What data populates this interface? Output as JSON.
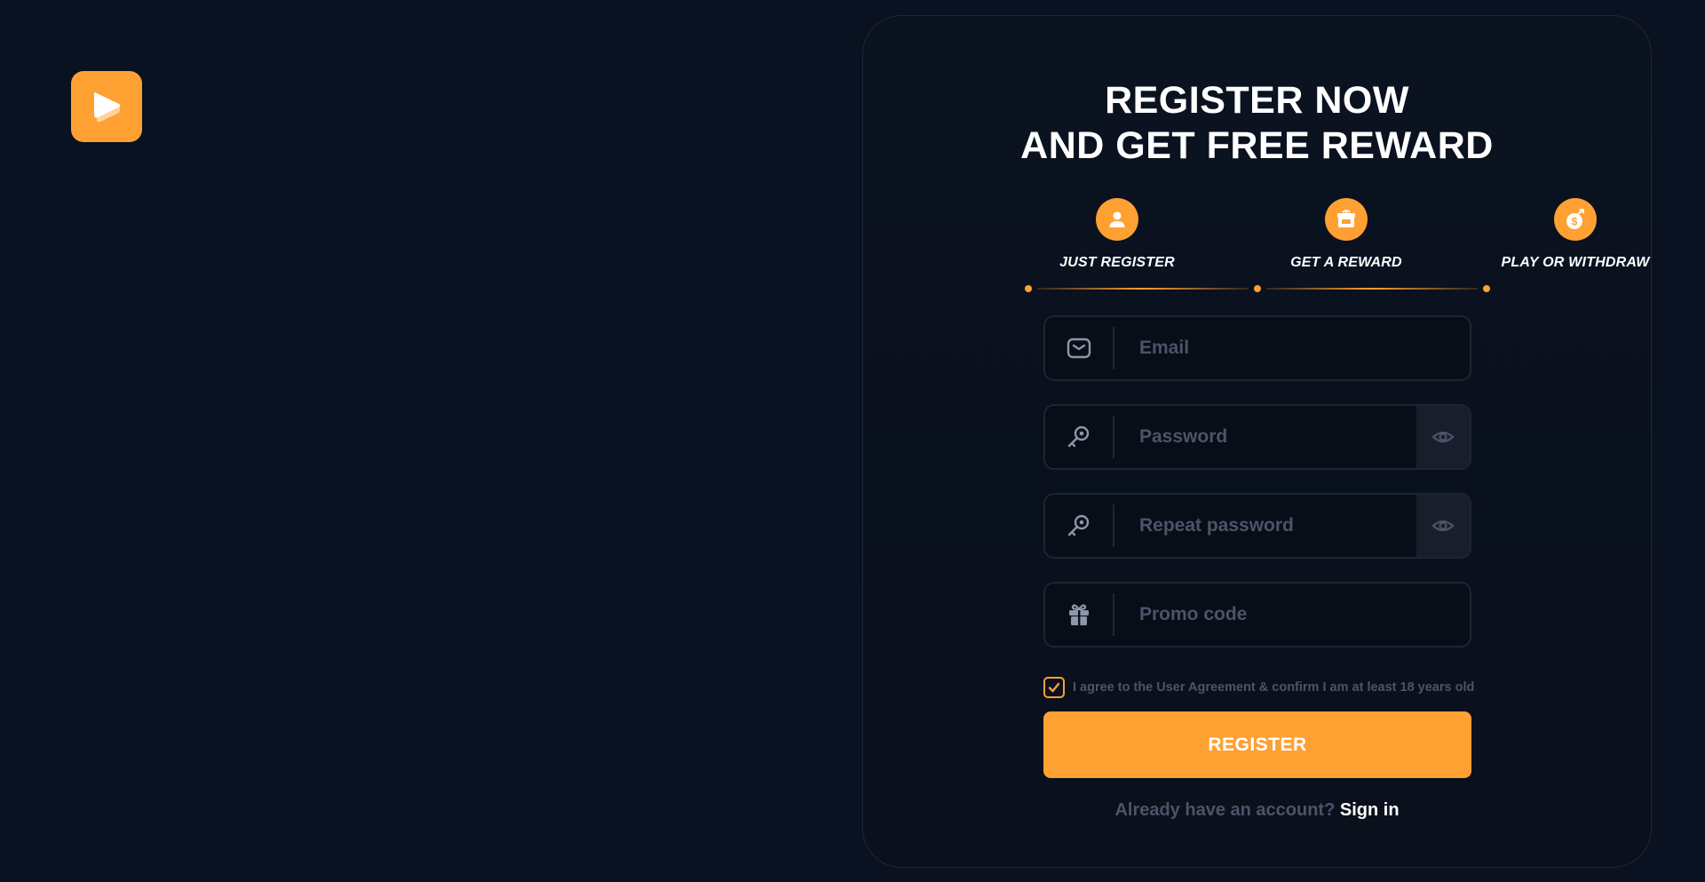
{
  "brand": {
    "accent": "#ffa033",
    "background": "#0a1120",
    "logo_icon": "play-icon"
  },
  "register": {
    "title_line1": "REGISTER NOW",
    "title_line2": "AND GET FREE REWARD",
    "steps": [
      {
        "label": "JUST REGISTER",
        "icon": "user-icon"
      },
      {
        "label": "GET A REWARD",
        "icon": "gift-box-icon"
      },
      {
        "label": "PLAY OR WITHDRAW",
        "icon": "money-bag-icon"
      }
    ],
    "fields": {
      "email": {
        "placeholder": "Email",
        "value": "",
        "icon": "mail-icon"
      },
      "password": {
        "placeholder": "Password",
        "value": "",
        "icon": "key-icon"
      },
      "repeat_password": {
        "placeholder": "Repeat password",
        "value": "",
        "icon": "key-icon"
      },
      "promo": {
        "placeholder": "Promo code",
        "value": "",
        "icon": "gift-icon"
      }
    },
    "agree_text": "I agree to the User Agreement & confirm I am at least 18 years old",
    "agree_checked": true,
    "submit_label": "REGISTER",
    "have_account": "Already have an account?",
    "signin_label": "Sign in"
  }
}
